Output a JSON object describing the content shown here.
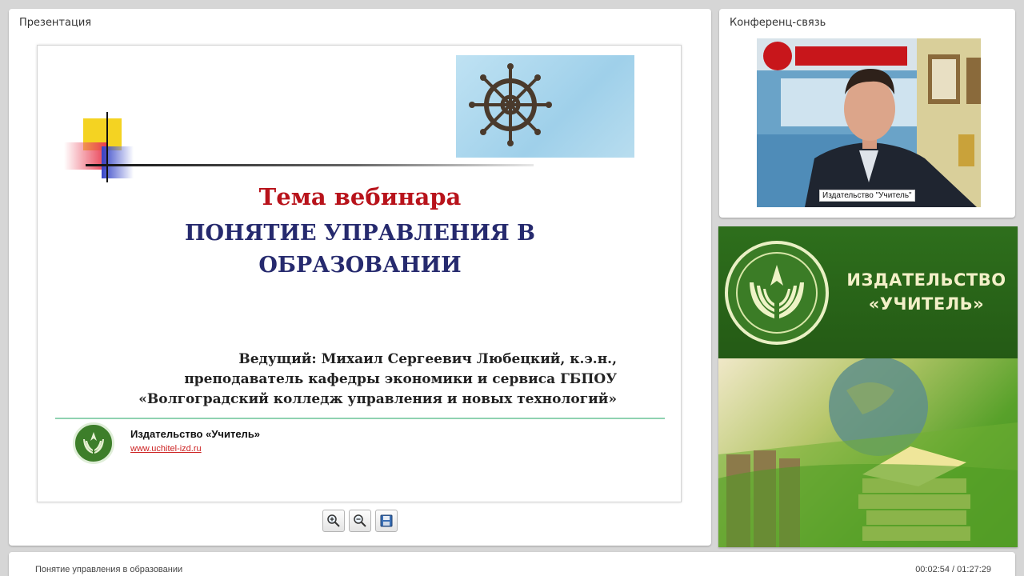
{
  "presentation": {
    "panel_title": "Презентация",
    "slide": {
      "topic_label": "Тема вебинара",
      "topic_line1": "ПОНЯТИЕ УПРАВЛЕНИЯ В",
      "topic_line2": "ОБРАЗОВАНИИ",
      "lead_line1": "Ведущий: Михаил Сергеевич Любецкий, к.э.н.,",
      "lead_line2": "преподаватель кафедры экономики и сервиса ГБПОУ",
      "lead_line3": "«Волгоградский колледж управления и новых технологий»",
      "publisher": "Издательство «Учитель»",
      "url": "www.uchitel-izd.ru"
    },
    "toolbar": {
      "zoom_in_icon": "zoom-in-icon",
      "zoom_out_icon": "zoom-out-icon",
      "save_icon": "save-icon"
    }
  },
  "conference": {
    "panel_title": "Конференц-связь",
    "participant_label": "Издательство \"Учитель\""
  },
  "banner": {
    "line1": "ИЗДАТЕЛЬСТВО",
    "line2": "«УЧИТЕЛЬ»"
  },
  "footer": {
    "title": "Понятие управления в образовании",
    "time": "00:02:54 / 01:27:29"
  },
  "colors": {
    "topic_label": "#b8131b",
    "topic": "#262a6e",
    "banner_green": "#2e6f1c",
    "banner_text": "#f3f0c8"
  }
}
